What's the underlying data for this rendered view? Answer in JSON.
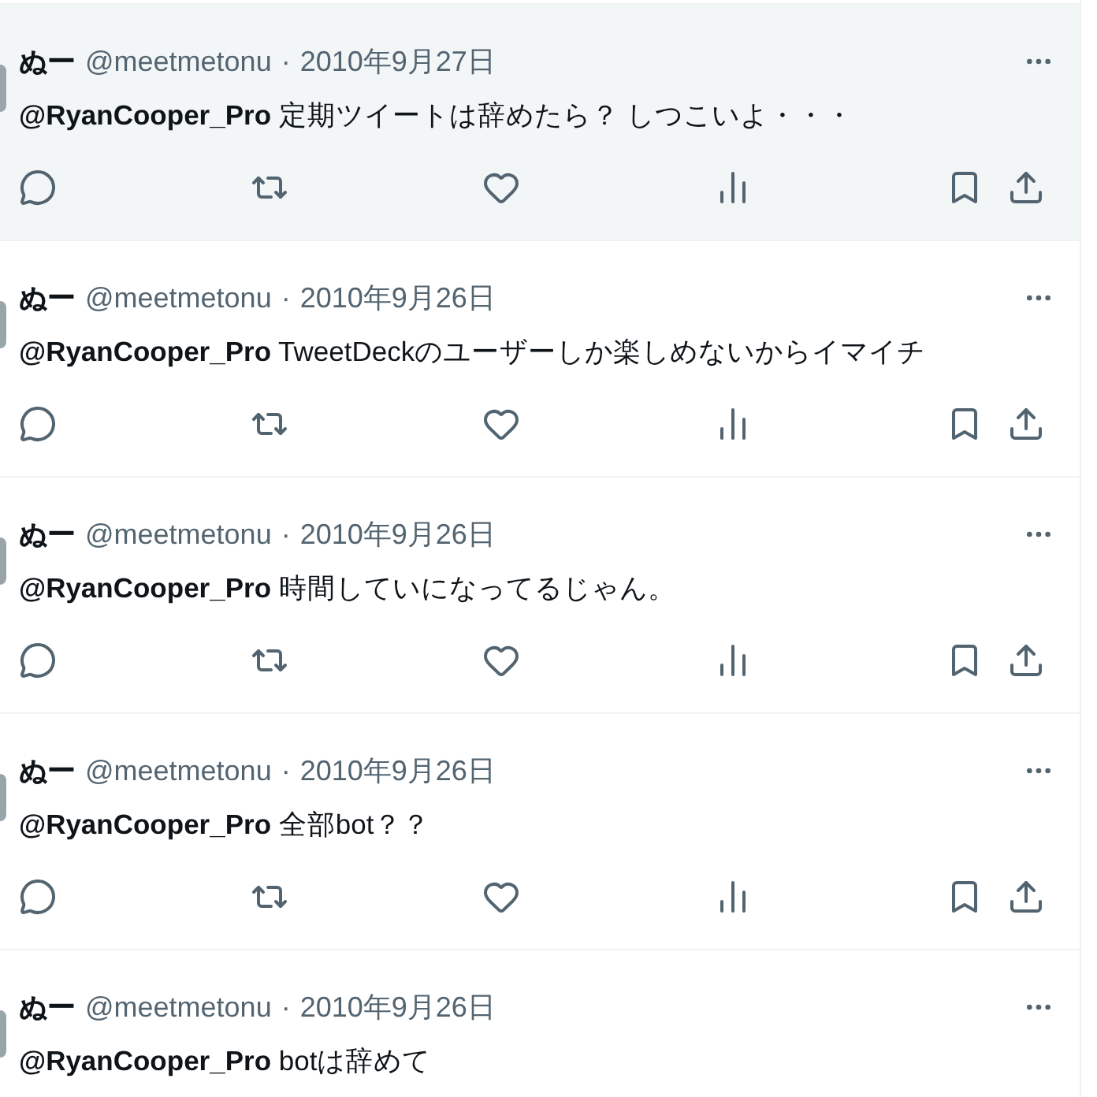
{
  "tweets": [
    {
      "name": "ぬー",
      "handle": "@meetmetonu",
      "separator": "·",
      "date": "2010年9月27日",
      "text": "**@RyanCooper_Pro** 定期ツイートは辞めたら？ しつこいよ・・・",
      "highlighted": true,
      "actions_shown": true
    },
    {
      "name": "ぬー",
      "handle": "@meetmetonu",
      "separator": "·",
      "date": "2010年9月26日",
      "text": "**@RyanCooper_Pro** TweetDeckのユーザーしか楽しめないからイマイチ",
      "highlighted": false,
      "actions_shown": true
    },
    {
      "name": "ぬー",
      "handle": "@meetmetonu",
      "separator": "·",
      "date": "2010年9月26日",
      "text": "**@RyanCooper_Pro** 時間していになってるじゃん。",
      "highlighted": false,
      "actions_shown": true
    },
    {
      "name": "ぬー",
      "handle": "@meetmetonu",
      "separator": "·",
      "date": "2010年9月26日",
      "text": "**@RyanCooper_Pro** 全部bot？？",
      "highlighted": false,
      "actions_shown": true
    },
    {
      "name": "ぬー",
      "handle": "@meetmetonu",
      "separator": "·",
      "date": "2010年9月26日",
      "text": "**@RyanCooper_Pro** botは辞めて",
      "highlighted": false,
      "actions_shown": false
    }
  ]
}
